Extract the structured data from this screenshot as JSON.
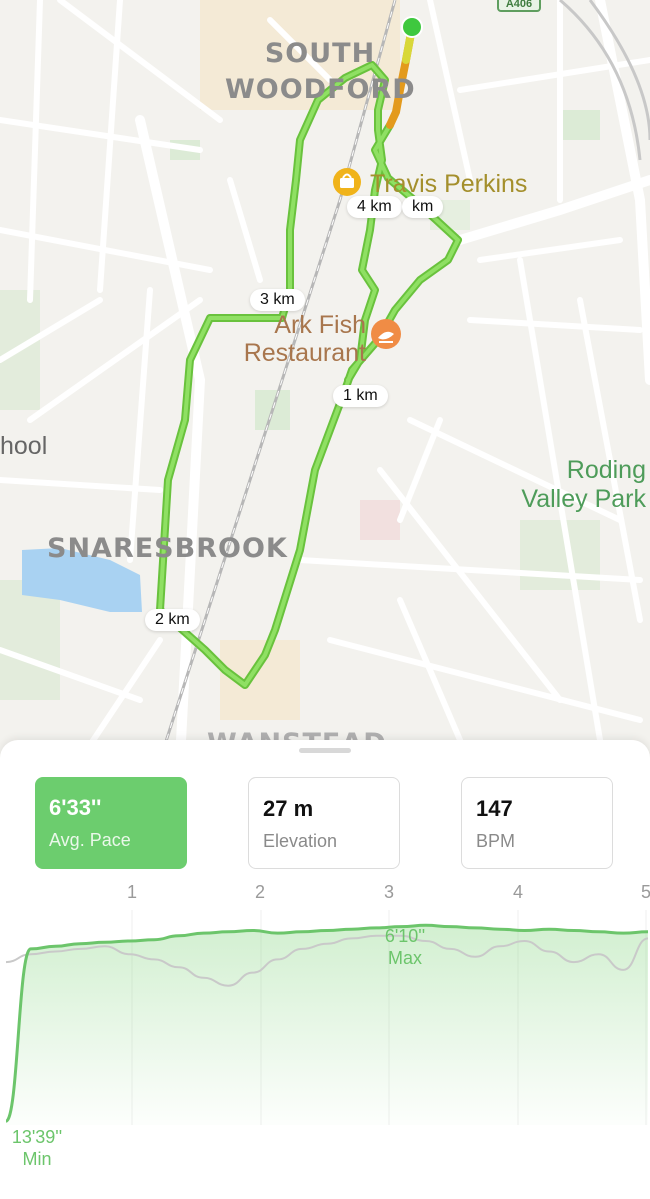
{
  "map": {
    "road_badge": "A406",
    "places": {
      "south_woodford_line1": "SOUTH",
      "south_woodford_line2": "WOODFORD",
      "snaresbrook": "SNARESBROOK",
      "wanstead": "WANSTEAD",
      "school_partial": "hool",
      "roding_line1": "Roding",
      "roding_line2": "Valley Park"
    },
    "pois": {
      "travis_perkins": "Travis Perkins",
      "ark_fish_line1": "Ark Fish",
      "ark_fish_line2": "Restaurant"
    },
    "km_markers": {
      "km1": "1 km",
      "km2": "2 km",
      "km3": "3 km",
      "km4": "4 km",
      "km5": "km"
    },
    "colors": {
      "route": "#6dcd45",
      "start_dot": "#3ec83e",
      "poi_brown": "#a8764d",
      "poi_gold": "#a48f2c",
      "park_green": "#4e9c5a",
      "water": "#a9d2f2"
    }
  },
  "stats": {
    "pace": {
      "value": "6'33''",
      "label": "Avg. Pace"
    },
    "elevation": {
      "value": "27 m",
      "label": "Elevation"
    },
    "bpm": {
      "value": "147",
      "label": "BPM"
    },
    "selected": "pace"
  },
  "chart_data": {
    "type": "area",
    "x_ticks": [
      "1",
      "2",
      "3",
      "4",
      "5"
    ],
    "xlabel": "",
    "ylabel": "",
    "series": [
      {
        "values": [
          13.65,
          7.1,
          7.0,
          6.9,
          6.85,
          6.8,
          6.75,
          6.6,
          6.5,
          6.45,
          6.4,
          6.5,
          6.45,
          6.4,
          6.35,
          6.3,
          6.25,
          6.2,
          6.25,
          6.3,
          6.35,
          6.4,
          6.35,
          6.4,
          6.45,
          6.5,
          6.45
        ]
      },
      {
        "values": [
          7.6,
          7.3,
          7.2,
          7.1,
          7.0,
          7.3,
          7.5,
          7.8,
          8.2,
          8.5,
          8.0,
          7.5,
          7.1,
          6.9,
          6.7,
          6.6,
          6.6,
          6.8,
          7.1,
          7.4,
          7.0,
          6.8,
          7.2,
          7.6,
          7.3,
          7.9,
          6.7
        ]
      }
    ],
    "annotations": {
      "max": {
        "value": "6'10''",
        "label": "Max"
      },
      "min": {
        "value": "13'39''",
        "label": "Min"
      }
    },
    "colors": {
      "pace": "#6cc56b",
      "elevation": "#c9c9c9"
    }
  }
}
